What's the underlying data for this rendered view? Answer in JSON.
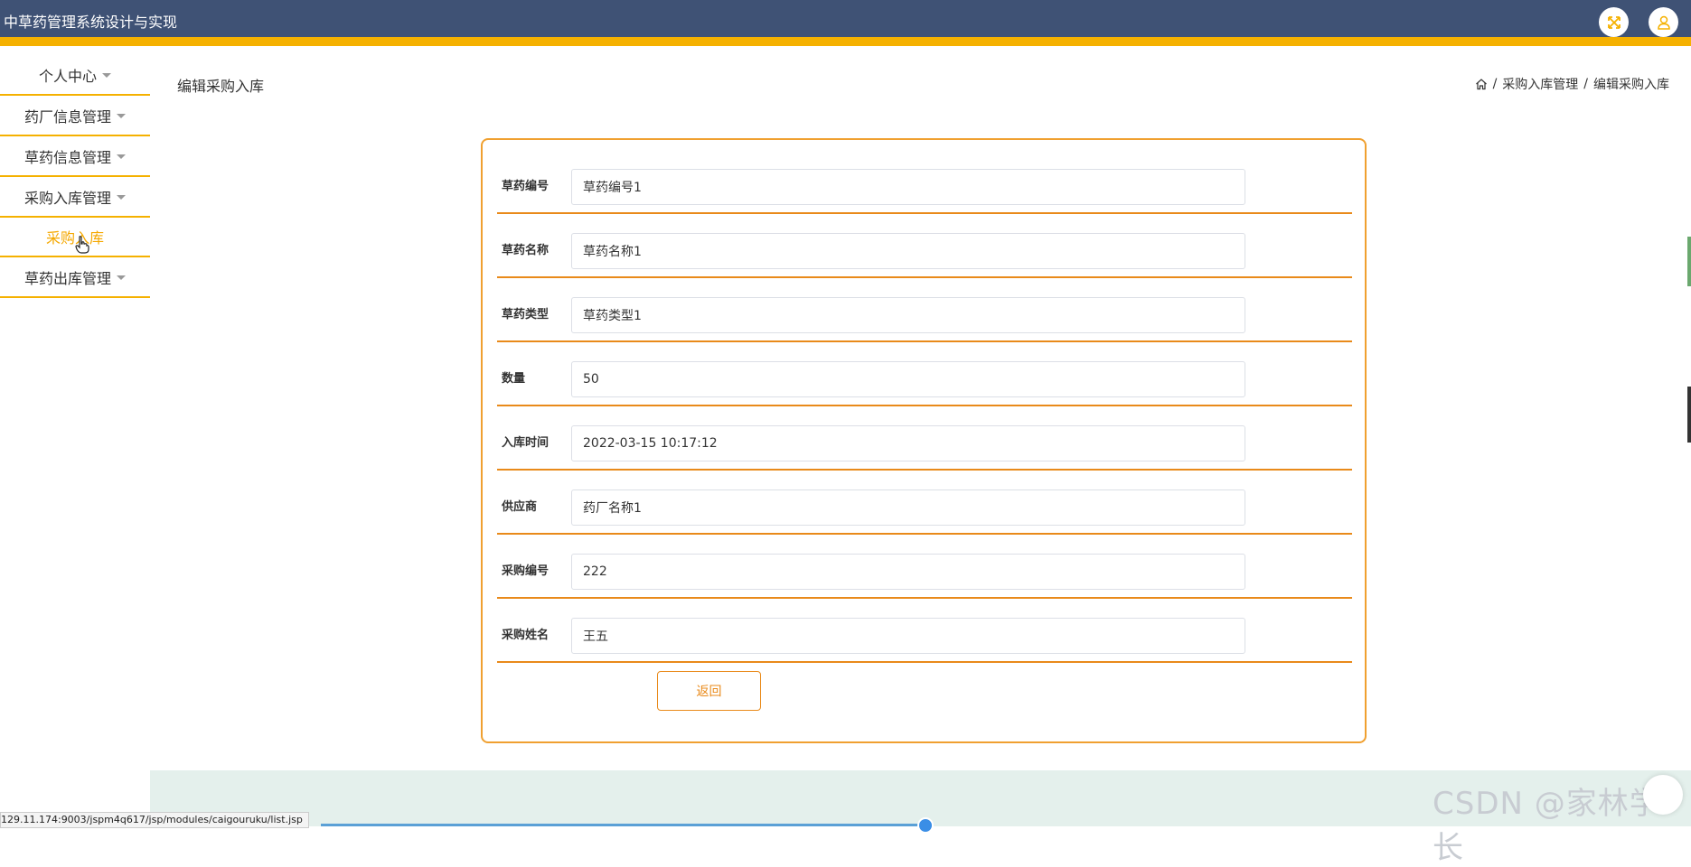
{
  "app": {
    "title": "中草药管理系统设计与实现"
  },
  "colors": {
    "header_bg": "#3f5275",
    "accent": "#f5b100",
    "form_border": "#e98a1a"
  },
  "sidebar": {
    "items": [
      {
        "label": "个人中心"
      },
      {
        "label": "药厂信息管理"
      },
      {
        "label": "草药信息管理"
      },
      {
        "label": "采购入库管理"
      },
      {
        "label": "采购入库"
      },
      {
        "label": "草药出库管理"
      }
    ]
  },
  "page": {
    "title": "编辑采购入库"
  },
  "breadcrumb": {
    "items": [
      "采购入库管理",
      "编辑采购入库"
    ]
  },
  "form": {
    "fields": [
      {
        "label": "草药编号",
        "value": "草药编号1"
      },
      {
        "label": "草药名称",
        "value": "草药名称1"
      },
      {
        "label": "草药类型",
        "value": "草药类型1"
      },
      {
        "label": "数量",
        "value": "50"
      },
      {
        "label": "入库时间",
        "value": "2022-03-15 10:17:12"
      },
      {
        "label": "供应商",
        "value": "药厂名称1"
      },
      {
        "label": "采购编号",
        "value": "222"
      },
      {
        "label": "采购姓名",
        "value": "王五"
      }
    ],
    "back_label": "返回"
  },
  "status_bar": {
    "url": "129.11.174:9003/jspm4q617/jsp/modules/caigouruku/list.jsp"
  },
  "watermark": "CSDN @家林学长"
}
